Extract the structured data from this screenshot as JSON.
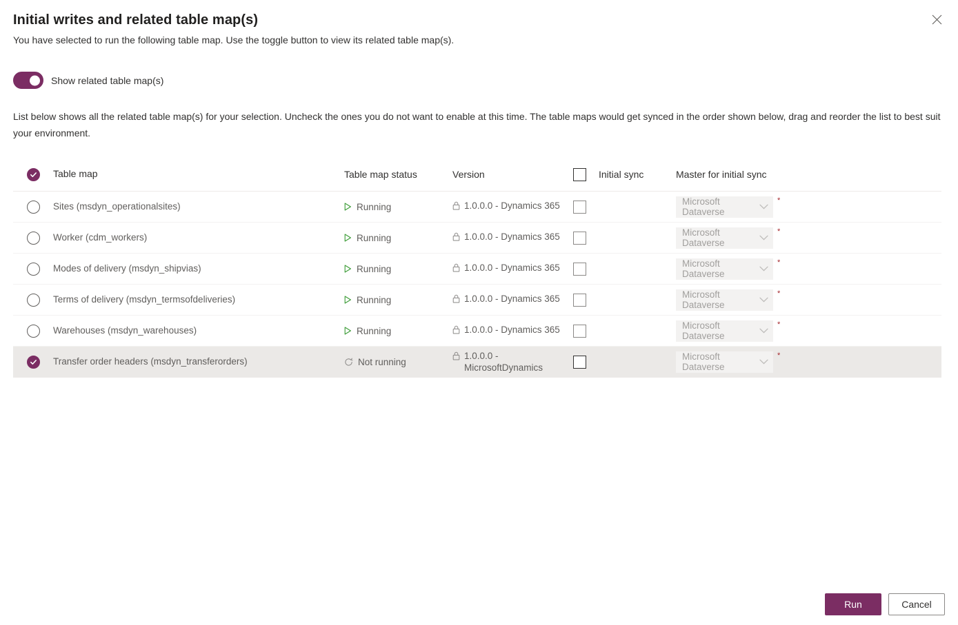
{
  "dialog": {
    "title": "Initial writes and related table map(s)",
    "subtitle": "You have selected to run the following table map. Use the toggle button to view its related table map(s).",
    "close_label": "Close",
    "intro": "List below shows all the related table map(s) for your selection. Uncheck the ones you do not want to enable at this time. The table maps would get synced in the order shown below, drag and reorder the list to best suit your environment.",
    "accent_color": "#7b2d63",
    "required_color": "#a4262c",
    "running_color": "#3a9b35",
    "selected_row_color": "#ebe9e7"
  },
  "toggle": {
    "label": "Show related table map(s)",
    "state": "on"
  },
  "table": {
    "headers": {
      "select_all": "select-all-checked",
      "table_map": "Table map",
      "status": "Table map status",
      "version": "Version",
      "initial_sync": "Initial sync",
      "master": "Master for initial sync"
    },
    "rows": [
      {
        "selected": false,
        "name": "Sites (msdyn_operationalsites)",
        "status": "Running",
        "status_icon": "play-icon",
        "version": "1.0.0.0 - Dynamics 365",
        "initial_sync_checked": false,
        "master": "Microsoft Dataverse",
        "master_required": "*"
      },
      {
        "selected": false,
        "name": "Worker (cdm_workers)",
        "status": "Running",
        "status_icon": "play-icon",
        "version": "1.0.0.0 - Dynamics 365",
        "initial_sync_checked": false,
        "master": "Microsoft Dataverse",
        "master_required": "*"
      },
      {
        "selected": false,
        "name": "Modes of delivery (msdyn_shipvias)",
        "status": "Running",
        "status_icon": "play-icon",
        "version": "1.0.0.0 - Dynamics 365",
        "initial_sync_checked": false,
        "master": "Microsoft Dataverse",
        "master_required": "*"
      },
      {
        "selected": false,
        "name": "Terms of delivery (msdyn_termsofdeliveries)",
        "status": "Running",
        "status_icon": "play-icon",
        "version": "1.0.0.0 - Dynamics 365",
        "initial_sync_checked": false,
        "master": "Microsoft Dataverse",
        "master_required": "*"
      },
      {
        "selected": false,
        "name": "Warehouses (msdyn_warehouses)",
        "status": "Running",
        "status_icon": "play-icon",
        "version": "1.0.0.0 - Dynamics 365",
        "initial_sync_checked": false,
        "master": "Microsoft Dataverse",
        "master_required": "*"
      },
      {
        "selected": true,
        "name": "Transfer order headers (msdyn_transferorders)",
        "status": "Not running",
        "status_icon": "sync-circle-icon",
        "version": "1.0.0.0 - MicrosoftDynamics",
        "initial_sync_checked": false,
        "master": "Microsoft Dataverse",
        "master_required": "*"
      }
    ]
  },
  "footer": {
    "run_label": "Run",
    "cancel_label": "Cancel"
  }
}
